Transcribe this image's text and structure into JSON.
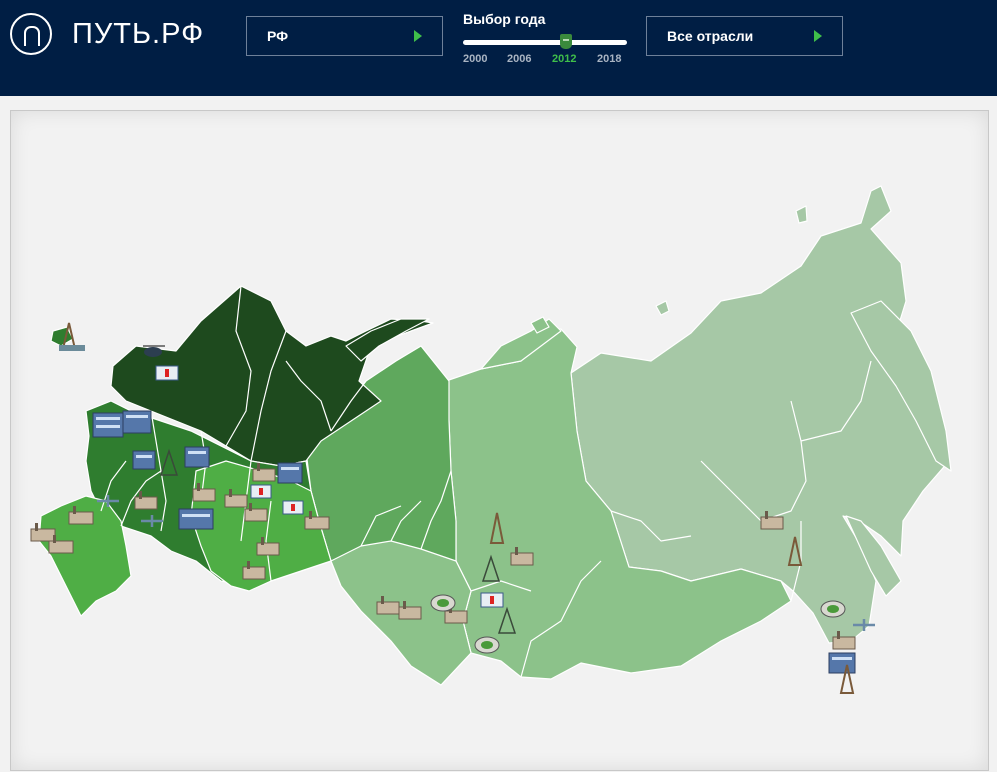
{
  "header": {
    "logo_text": "ПУТЬ.РФ",
    "region_selector": {
      "label": "РФ"
    },
    "year_selector": {
      "title": "Выбор года",
      "ticks": [
        "2000",
        "2006",
        "2012",
        "2018"
      ],
      "selected": "2012",
      "range": [
        2000,
        2018
      ]
    },
    "industry_selector": {
      "label": "Все отрасли"
    }
  },
  "colors": {
    "header_bg": "#001e44",
    "accent": "#3fbf4a",
    "map_dark": "#1e4a1e",
    "map_mid_dark": "#2f7d2f",
    "map_bright": "#4fae45",
    "map_mid": "#5fa85d",
    "map_light": "#8cc28a",
    "map_pale": "#a6c8a6"
  },
  "map": {
    "icons": [
      {
        "name": "oil-rig-icon"
      },
      {
        "name": "helicopter-icon"
      },
      {
        "name": "ambulance-icon"
      },
      {
        "name": "factory-icon"
      },
      {
        "name": "factory-icon"
      },
      {
        "name": "factory-icon"
      },
      {
        "name": "factory-icon"
      },
      {
        "name": "factory-icon"
      },
      {
        "name": "factory-icon"
      },
      {
        "name": "factory-icon"
      },
      {
        "name": "factory-icon"
      },
      {
        "name": "factory-icon"
      },
      {
        "name": "factory-icon"
      },
      {
        "name": "factory-icon"
      },
      {
        "name": "factory-icon"
      },
      {
        "name": "factory-icon"
      },
      {
        "name": "factory-icon"
      },
      {
        "name": "factory-icon"
      },
      {
        "name": "stadium-icon"
      },
      {
        "name": "stadium-icon"
      },
      {
        "name": "stadium-icon"
      },
      {
        "name": "power-tower-icon"
      },
      {
        "name": "power-tower-icon"
      },
      {
        "name": "power-tower-icon"
      },
      {
        "name": "oil-rig-icon"
      },
      {
        "name": "oil-rig-icon"
      },
      {
        "name": "oil-rig-icon"
      },
      {
        "name": "ambulance-icon"
      },
      {
        "name": "ambulance-icon"
      },
      {
        "name": "ambulance-icon"
      },
      {
        "name": "airplane-icon"
      },
      {
        "name": "airplane-icon"
      },
      {
        "name": "airplane-icon"
      },
      {
        "name": "building-icon"
      },
      {
        "name": "building-icon"
      },
      {
        "name": "building-icon"
      },
      {
        "name": "building-icon"
      },
      {
        "name": "building-icon"
      },
      {
        "name": "building-icon"
      },
      {
        "name": "truck-icon"
      },
      {
        "name": "truck-icon"
      },
      {
        "name": "truck-icon"
      }
    ]
  }
}
